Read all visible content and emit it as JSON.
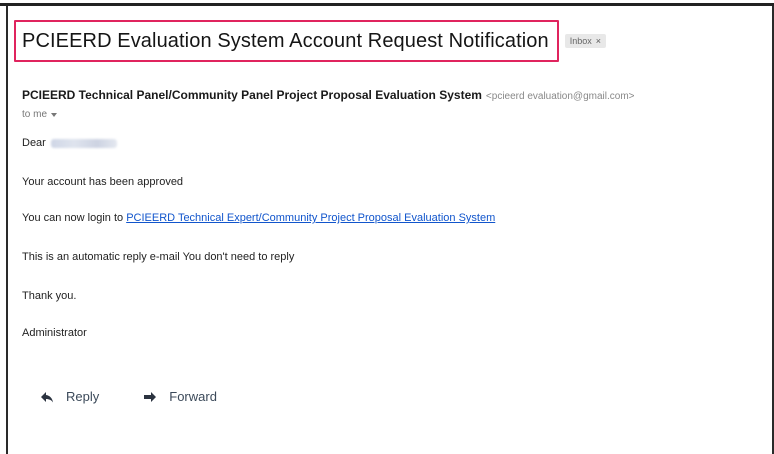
{
  "email": {
    "subject": "PCIEERD Evaluation System Account Request Notification",
    "label_chip": "Inbox",
    "label_close": "×",
    "sender_name": "PCIEERD Technical Panel/Community Panel Project Proposal Evaluation System",
    "sender_email": "<pcieerd evaluation@gmail.com>",
    "to_line": "to me",
    "greeting": "Dear",
    "approved": "Your account has been approved",
    "login_prefix": "You can now login to ",
    "login_link": "PCIEERD Technical Expert/Community Project Proposal Evaluation System",
    "auto_reply": "This is an automatic reply e-mail  You don't need to reply",
    "thanks": "Thank you.",
    "signature": "Administrator"
  },
  "actions": {
    "reply_label": "Reply",
    "forward_label": "Forward"
  },
  "colors": {
    "highlight_border": "#e0245e",
    "link": "#1155cc"
  }
}
